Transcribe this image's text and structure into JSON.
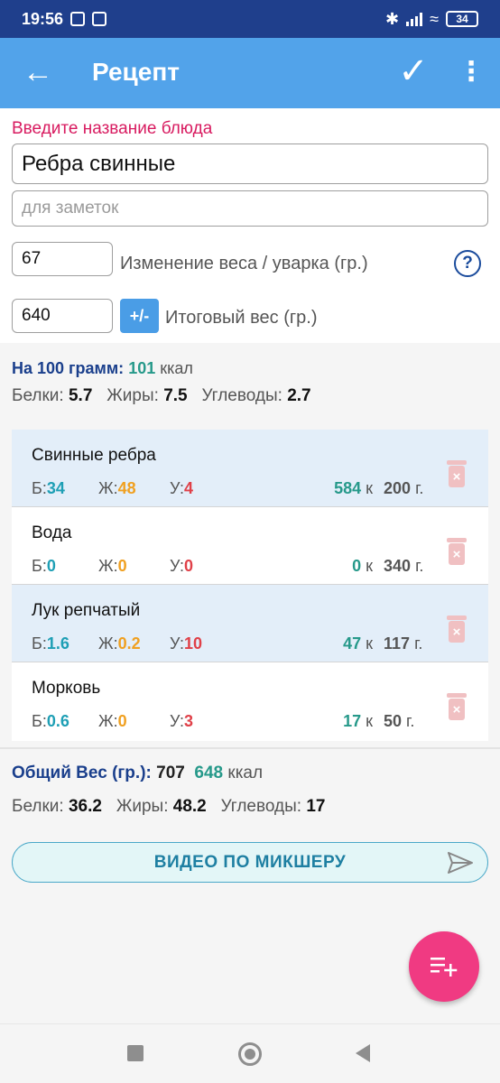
{
  "status_bar": {
    "time": "19:56",
    "battery": "34"
  },
  "app_bar": {
    "title": "Рецепт"
  },
  "form": {
    "hint": "Введите название блюда",
    "dish_name": "Ребра свинные",
    "notes_placeholder": "для заметок",
    "weight_change_value": "67",
    "weight_change_label": "Изменение веса / уварка (гр.)",
    "final_weight_value": "640",
    "plus_minus_label": "+/-",
    "final_weight_label": "Итоговый вес (гр.)"
  },
  "per100": {
    "label": "На 100 грамм:",
    "kcal_value": "101",
    "kcal_unit": "ккал",
    "protein_label": "Белки:",
    "protein": "5.7",
    "fat_label": "Жиры:",
    "fat": "7.5",
    "carbs_label": "Углеводы:",
    "carbs": "2.7"
  },
  "ingredients": [
    {
      "name": "Свинные ребра",
      "b": "34",
      "j": "48",
      "u": "4",
      "kcal": "584",
      "grams": "200",
      "highlighted": true
    },
    {
      "name": "Вода",
      "b": "0",
      "j": "0",
      "u": "0",
      "kcal": "0",
      "grams": "340",
      "highlighted": false
    },
    {
      "name": "Лук репчатый",
      "b": "1.6",
      "j": "0.2",
      "u": "10",
      "kcal": "47",
      "grams": "117",
      "highlighted": true
    },
    {
      "name": "Морковь",
      "b": "0.6",
      "j": "0",
      "u": "3",
      "kcal": "17",
      "grams": "50",
      "highlighted": false
    }
  ],
  "macro_labels": {
    "b": "Б:",
    "j": "Ж:",
    "u": "У:",
    "kcal_unit": "к",
    "gram_unit": "г."
  },
  "totals": {
    "label": "Общий Вес (гр.):",
    "weight": "707",
    "kcal_value": "648",
    "kcal_unit": "ккал",
    "protein_label": "Белки:",
    "protein": "36.2",
    "fat_label": "Жиры:",
    "fat": "48.2",
    "carbs_label": "Углеводы:",
    "carbs": "17"
  },
  "video_button": {
    "label": "ВИДЕО ПО МИКШЕРУ"
  },
  "icons": {
    "back": "arrow-left-icon",
    "confirm": "check-icon",
    "menu": "more-vert-icon",
    "help": "help-circle-icon",
    "delete": "trash-icon",
    "send": "send-icon",
    "add_list": "playlist-add-icon"
  },
  "colors": {
    "app_bar": "#52a3ea",
    "status_bar": "#1f3f8c",
    "accent_pink": "#f03a82",
    "hint": "#d81b60",
    "protein": "#1e9fb5",
    "fat": "#f0a020",
    "carbs": "#e04048",
    "kcal": "#26998a"
  }
}
